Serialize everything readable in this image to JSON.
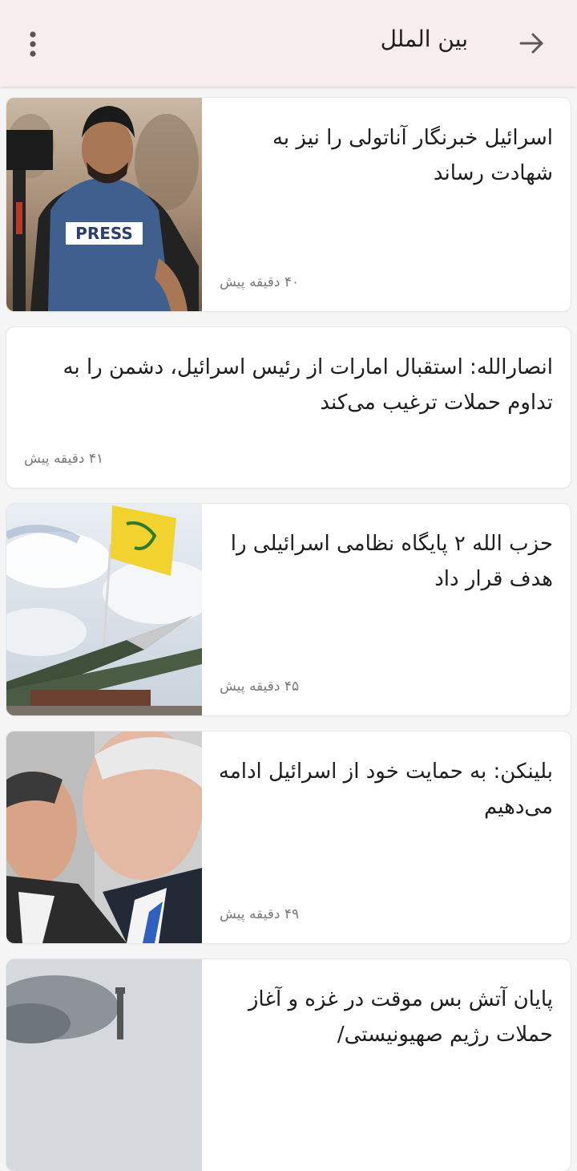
{
  "header": {
    "title": "بین الملل",
    "back_icon": "arrow-forward-icon",
    "menu_icon": "more-vert-icon"
  },
  "news": [
    {
      "headline": "اسرائیل خبرنگار آناتولی را نیز به شهادت رساند",
      "time": "۴۰ دقیقه پیش",
      "image": "journalist-press-vest-photo"
    },
    {
      "headline": "انصارالله: استقبال امارات از رئیس اسرائیل، دشمن را به تداوم حملات ترغیب می‌کند",
      "time": "۴۱ دقیقه پیش"
    },
    {
      "headline": "حزب الله ۲ پایگاه نظامی اسرائیلی را هدف قرار داد",
      "time": "۴۵ دقیقه پیش",
      "image": "rockets-and-flag-photo"
    },
    {
      "headline": "بلینکن: به حمایت خود از اسرائیل ادامه می‌دهیم",
      "time": "۴۹ دقیقه پیش",
      "image": "politicians-photo"
    },
    {
      "headline": "پایان آتش بس موقت در غزه و آغاز حملات رژیم صهیونیستی/",
      "time": "",
      "image": "gaza-skyline-photo"
    }
  ]
}
